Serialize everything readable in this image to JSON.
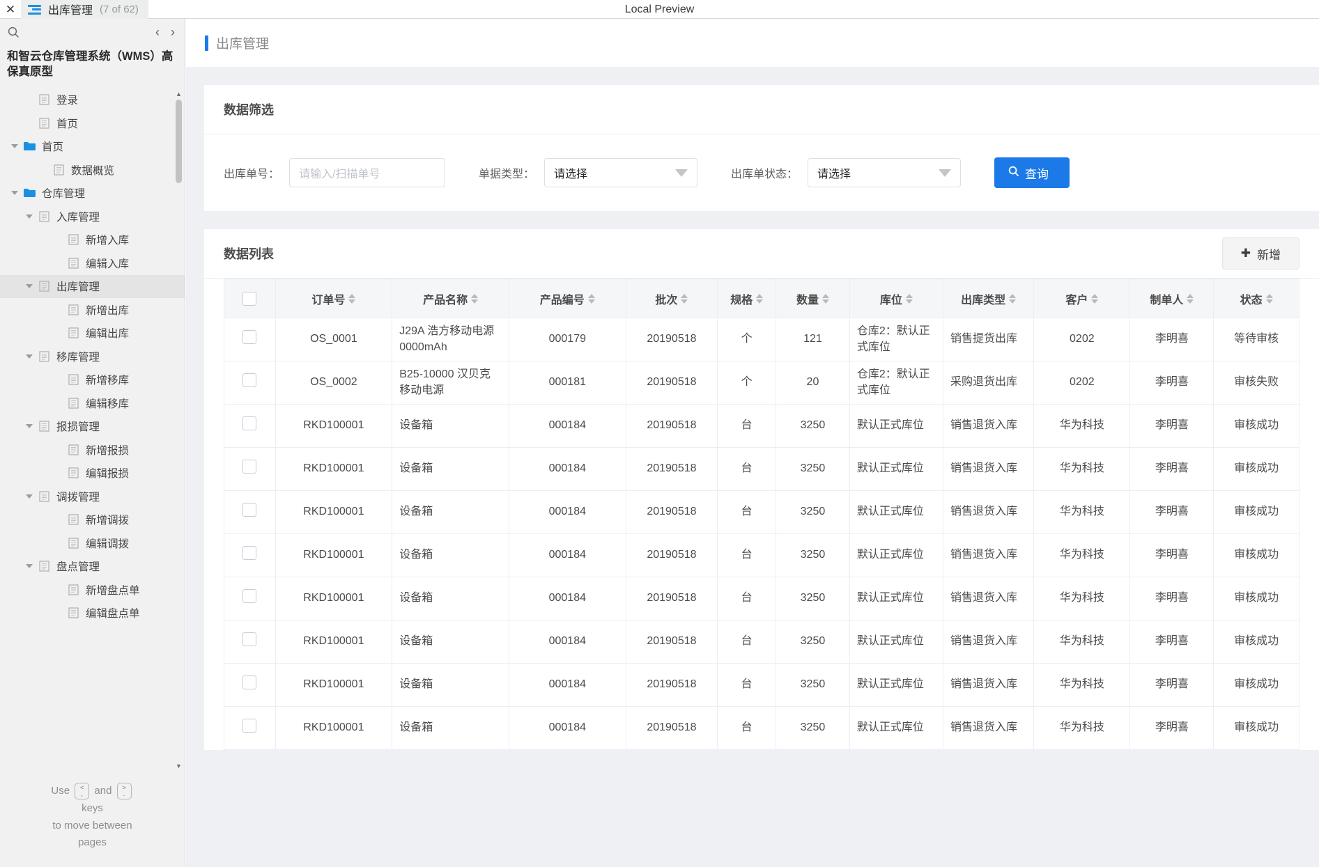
{
  "titlebar": {
    "close_icon": "close-icon",
    "menu_icon": "hamburger-icon",
    "tab_title": "出库管理",
    "tab_count": "(7 of 62)",
    "center_label": "Local Preview"
  },
  "sidebar": {
    "search_icon": "search-icon",
    "prev_icon": "‹",
    "next_icon": "›",
    "project_title": "和智云仓库管理系统（WMS）高保真原型",
    "tree": [
      {
        "label": "登录",
        "icon": "page-icon",
        "indent": 1,
        "caret": false,
        "selected": false
      },
      {
        "label": "首页",
        "icon": "page-icon",
        "indent": 1,
        "caret": false,
        "selected": false
      },
      {
        "label": "首页",
        "icon": "folder-icon",
        "indent": 0,
        "caret": true,
        "selected": false
      },
      {
        "label": "数据概览",
        "icon": "page-icon",
        "indent": 2,
        "caret": false,
        "selected": false
      },
      {
        "label": "仓库管理",
        "icon": "folder-icon",
        "indent": 0,
        "caret": true,
        "selected": false
      },
      {
        "label": "入库管理",
        "icon": "page-icon",
        "indent": 1,
        "caret": true,
        "selected": false
      },
      {
        "label": "新增入库",
        "icon": "page-icon",
        "indent": 3,
        "caret": false,
        "selected": false
      },
      {
        "label": "编辑入库",
        "icon": "page-icon",
        "indent": 3,
        "caret": false,
        "selected": false
      },
      {
        "label": "出库管理",
        "icon": "page-icon",
        "indent": 1,
        "caret": true,
        "selected": true
      },
      {
        "label": "新增出库",
        "icon": "page-icon",
        "indent": 3,
        "caret": false,
        "selected": false
      },
      {
        "label": "编辑出库",
        "icon": "page-icon",
        "indent": 3,
        "caret": false,
        "selected": false
      },
      {
        "label": "移库管理",
        "icon": "page-icon",
        "indent": 1,
        "caret": true,
        "selected": false
      },
      {
        "label": "新增移库",
        "icon": "page-icon",
        "indent": 3,
        "caret": false,
        "selected": false
      },
      {
        "label": "编辑移库",
        "icon": "page-icon",
        "indent": 3,
        "caret": false,
        "selected": false
      },
      {
        "label": "报损管理",
        "icon": "page-icon",
        "indent": 1,
        "caret": true,
        "selected": false
      },
      {
        "label": "新增报损",
        "icon": "page-icon",
        "indent": 3,
        "caret": false,
        "selected": false
      },
      {
        "label": "编辑报损",
        "icon": "page-icon",
        "indent": 3,
        "caret": false,
        "selected": false
      },
      {
        "label": "调拨管理",
        "icon": "page-icon",
        "indent": 1,
        "caret": true,
        "selected": false
      },
      {
        "label": "新增调拨",
        "icon": "page-icon",
        "indent": 3,
        "caret": false,
        "selected": false
      },
      {
        "label": "编辑调拨",
        "icon": "page-icon",
        "indent": 3,
        "caret": false,
        "selected": false
      },
      {
        "label": "盘点管理",
        "icon": "page-icon",
        "indent": 1,
        "caret": true,
        "selected": false
      },
      {
        "label": "新增盘点单",
        "icon": "page-icon",
        "indent": 3,
        "caret": false,
        "selected": false
      },
      {
        "label": "编辑盘点单",
        "icon": "page-icon",
        "indent": 3,
        "caret": false,
        "selected": false
      }
    ],
    "hint": {
      "use": "Use",
      "key_prev_top": "<",
      "key_prev_bottom": ",",
      "and": "and",
      "key_next_top": ">",
      "key_next_bottom": ".",
      "line2": "keys",
      "line3": "to move between",
      "line4": "pages"
    }
  },
  "page": {
    "title": "出库管理",
    "accent_color": "#1b7ae8"
  },
  "filter_panel": {
    "heading": "数据筛选",
    "order_no_label": "出库单号：",
    "order_no_placeholder": "请输入/扫描单号",
    "order_no_value": "",
    "doc_type_label": "单据类型：",
    "doc_type_value": "请选择",
    "status_label": "出库单状态：",
    "status_value": "请选择",
    "search_button": "查询",
    "search_icon": "search-icon"
  },
  "list_panel": {
    "heading": "数据列表",
    "add_button": "新增",
    "add_icon": "plus-icon"
  },
  "table": {
    "select_all_checkbox": "select-all-checkbox",
    "columns": [
      {
        "key": "checkbox",
        "label": "",
        "sortable": false
      },
      {
        "key": "order_no",
        "label": "订单号",
        "sortable": true
      },
      {
        "key": "product_name",
        "label": "产品名称",
        "sortable": true
      },
      {
        "key": "product_code",
        "label": "产品编号",
        "sortable": true
      },
      {
        "key": "batch",
        "label": "批次",
        "sortable": true
      },
      {
        "key": "spec",
        "label": "规格",
        "sortable": true
      },
      {
        "key": "qty",
        "label": "数量",
        "sortable": true
      },
      {
        "key": "location",
        "label": "库位",
        "sortable": true
      },
      {
        "key": "out_type",
        "label": "出库类型",
        "sortable": true
      },
      {
        "key": "customer",
        "label": "客户",
        "sortable": true
      },
      {
        "key": "maker",
        "label": "制单人",
        "sortable": true
      },
      {
        "key": "status",
        "label": "状态",
        "sortable": true
      }
    ],
    "rows": [
      {
        "order_no": "OS_0001",
        "product_name": "J29A 浩方移动电源 0000mAh",
        "product_code": "000179",
        "batch": "20190518",
        "spec": "个",
        "qty": "121",
        "location": "仓库2：默认正式库位",
        "out_type": "销售提货出库",
        "customer": "0202",
        "maker": "李明喜",
        "status": "等待审核"
      },
      {
        "order_no": "OS_0002",
        "product_name": "B25-10000 汉贝克移动电源",
        "product_code": "000181",
        "batch": "20190518",
        "spec": "个",
        "qty": "20",
        "location": "仓库2：默认正式库位",
        "out_type": "采购退货出库",
        "customer": "0202",
        "maker": "李明喜",
        "status": "审核失败"
      },
      {
        "order_no": "RKD100001",
        "product_name": "设备箱",
        "product_code": "000184",
        "batch": "20190518",
        "spec": "台",
        "qty": "3250",
        "location": "默认正式库位",
        "out_type": "销售退货入库",
        "customer": "华为科技",
        "maker": "李明喜",
        "status": "审核成功"
      },
      {
        "order_no": "RKD100001",
        "product_name": "设备箱",
        "product_code": "000184",
        "batch": "20190518",
        "spec": "台",
        "qty": "3250",
        "location": "默认正式库位",
        "out_type": "销售退货入库",
        "customer": "华为科技",
        "maker": "李明喜",
        "status": "审核成功"
      },
      {
        "order_no": "RKD100001",
        "product_name": "设备箱",
        "product_code": "000184",
        "batch": "20190518",
        "spec": "台",
        "qty": "3250",
        "location": "默认正式库位",
        "out_type": "销售退货入库",
        "customer": "华为科技",
        "maker": "李明喜",
        "status": "审核成功"
      },
      {
        "order_no": "RKD100001",
        "product_name": "设备箱",
        "product_code": "000184",
        "batch": "20190518",
        "spec": "台",
        "qty": "3250",
        "location": "默认正式库位",
        "out_type": "销售退货入库",
        "customer": "华为科技",
        "maker": "李明喜",
        "status": "审核成功"
      },
      {
        "order_no": "RKD100001",
        "product_name": "设备箱",
        "product_code": "000184",
        "batch": "20190518",
        "spec": "台",
        "qty": "3250",
        "location": "默认正式库位",
        "out_type": "销售退货入库",
        "customer": "华为科技",
        "maker": "李明喜",
        "status": "审核成功"
      },
      {
        "order_no": "RKD100001",
        "product_name": "设备箱",
        "product_code": "000184",
        "batch": "20190518",
        "spec": "台",
        "qty": "3250",
        "location": "默认正式库位",
        "out_type": "销售退货入库",
        "customer": "华为科技",
        "maker": "李明喜",
        "status": "审核成功"
      },
      {
        "order_no": "RKD100001",
        "product_name": "设备箱",
        "product_code": "000184",
        "batch": "20190518",
        "spec": "台",
        "qty": "3250",
        "location": "默认正式库位",
        "out_type": "销售退货入库",
        "customer": "华为科技",
        "maker": "李明喜",
        "status": "审核成功"
      },
      {
        "order_no": "RKD100001",
        "product_name": "设备箱",
        "product_code": "000184",
        "batch": "20190518",
        "spec": "台",
        "qty": "3250",
        "location": "默认正式库位",
        "out_type": "销售退货入库",
        "customer": "华为科技",
        "maker": "李明喜",
        "status": "审核成功"
      }
    ]
  }
}
